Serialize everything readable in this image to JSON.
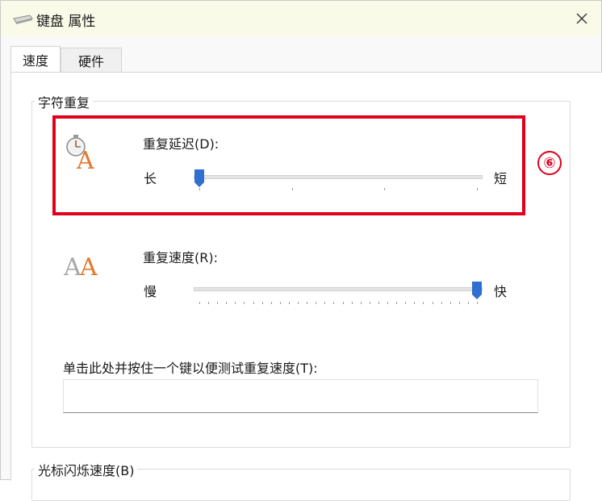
{
  "window": {
    "title": "键盘 属性",
    "icon": "keyboard-icon",
    "close_icon": "close-icon"
  },
  "tabs": [
    {
      "label": "速度",
      "selected": true
    },
    {
      "label": "硬件",
      "selected": false
    }
  ],
  "repeat_group": {
    "legend": "字符重复",
    "delay": {
      "label": "重复延迟(D):",
      "left_label": "长",
      "right_label": "短",
      "icon": "stopwatch-letter-a-icon",
      "value_fraction": 0.0
    },
    "rate": {
      "label": "重复速度(R):",
      "left_label": "慢",
      "right_label": "快",
      "icon": "double-letter-a-icon",
      "value_fraction": 1.0
    },
    "test": {
      "label": "单击此处并按住一个键以便测试重复速度(T):",
      "value": ""
    }
  },
  "blink_group": {
    "legend": "光标闪烁速度(B)"
  },
  "annotation": {
    "badge_text": "⑥",
    "color": "#e0001b"
  },
  "colors": {
    "slider_thumb": "#2f6fd1",
    "titlebar": "#fafae8"
  }
}
